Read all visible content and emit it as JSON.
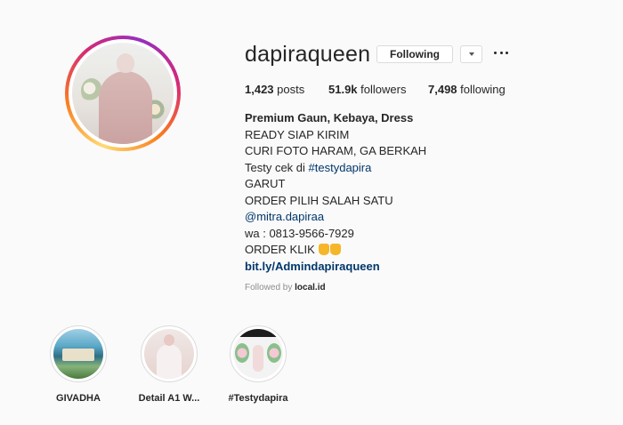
{
  "profile": {
    "username": "dapiraqueen",
    "follow_button": "Following",
    "stats": {
      "posts_count": "1,423",
      "posts_label": "posts",
      "followers_count": "51.9k",
      "followers_label": "followers",
      "following_count": "7,498",
      "following_label": "following"
    },
    "bio": {
      "name": "Premium Gaun, Kebaya, Dress",
      "line1": "READY SIAP KIRIM",
      "line2": "CURI FOTO HARAM, GA BERKAH",
      "line3_prefix": "Testy cek di ",
      "line3_tag": "#testydapira",
      "line4": "GARUT",
      "line5": "ORDER PILIH SALAH SATU",
      "line6_mention": "@mitra.dapiraa",
      "line7": "wa : 0813-9566-7929",
      "line8": "ORDER KLIK",
      "link": "bit.ly/Admindapiraqueen"
    },
    "followed_by_prefix": "Followed by ",
    "followed_by_user": "local.id"
  },
  "highlights": [
    {
      "label": "GIVADHA"
    },
    {
      "label": "Detail A1 W..."
    },
    {
      "label": "#Testydapira"
    }
  ],
  "icons": {
    "dropdown": "chevron-down-icon",
    "more": "more-options-icon",
    "emoji": "pointing-down-emoji"
  }
}
